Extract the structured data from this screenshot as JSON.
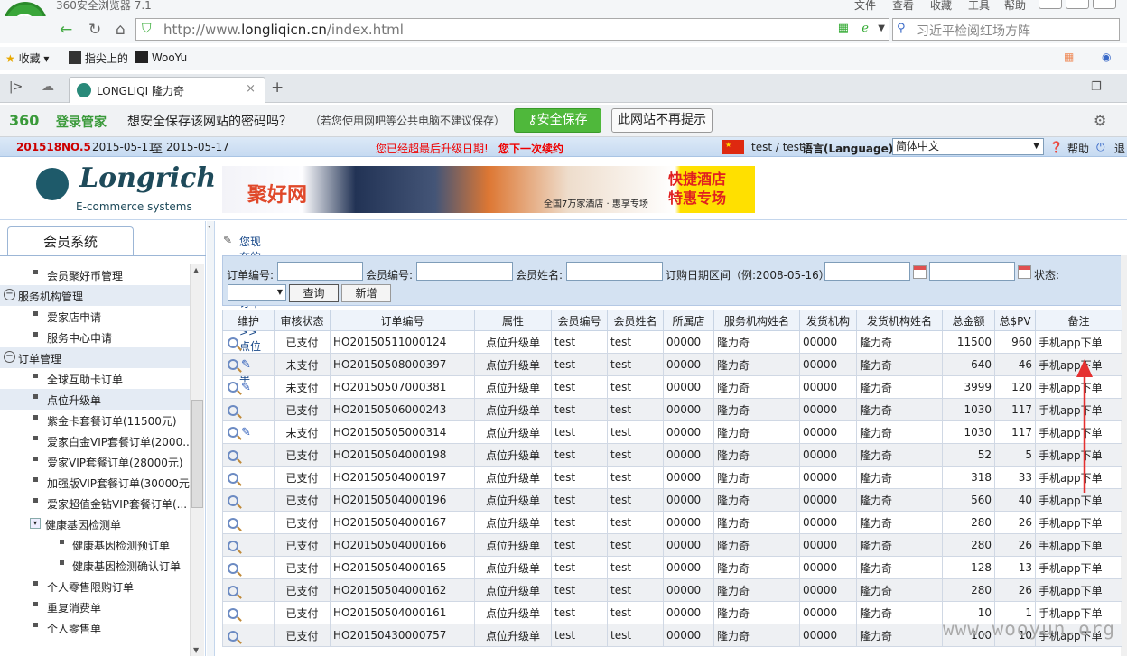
{
  "browser": {
    "app_title": "360安全浏览器 7.1",
    "menus": [
      "文件",
      "查看",
      "收藏",
      "工具",
      "帮助"
    ],
    "url_prefix": "http://www.",
    "url_host": "longliqicn.cn",
    "url_path": "/index.html",
    "search_text": "习近平检阅红场方阵",
    "bookmarks": [
      "收藏",
      "指尖上的",
      "WooYu"
    ],
    "tab_title": "LONGLIQI 隆力奇",
    "pw_brand": "360",
    "pw_mgr": "登录管家",
    "pw_question": "想安全保存该网站的密码吗？",
    "pw_note": "（若您使用网吧等公共电脑不建议保存）",
    "pw_save": "安全保存",
    "pw_no": "此网站不再提示"
  },
  "info": {
    "period": "201518",
    "no_label": "NO.5",
    "date_from": "2015-05-11",
    "date_sep": "至",
    "date_to": "2015-05-17",
    "notice1": "您已经超最后升级日期!",
    "notice2": "您下一次续约",
    "user": "test / test",
    "lang_label": "语言(Language):",
    "lang_value": "简体中文",
    "help": "帮助",
    "logout": "退"
  },
  "header": {
    "brand": "Longrich",
    "sub": "E-commerce systems",
    "banner_site": "聚好网",
    "banner_mid": "全国7万家酒店 · 惠享专场",
    "banner_right_1": "快捷酒店",
    "banner_right_2": "特惠专场"
  },
  "sidebar": {
    "tab": "会员系统",
    "items": [
      {
        "kind": "lv1",
        "label": "会员聚好币管理"
      },
      {
        "kind": "grp",
        "label": "服务机构管理"
      },
      {
        "kind": "lv1",
        "label": "爱家店申请"
      },
      {
        "kind": "lv1",
        "label": "服务中心申请"
      },
      {
        "kind": "grp",
        "label": "订单管理"
      },
      {
        "kind": "lv1",
        "label": "全球互助卡订单"
      },
      {
        "kind": "lv1",
        "label": "点位升级单",
        "active": true
      },
      {
        "kind": "lv1",
        "label": "紫金卡套餐订单(11500元)"
      },
      {
        "kind": "lv1",
        "label": "爱家白金VIP套餐订单(2000..."
      },
      {
        "kind": "lv1",
        "label": "爱家VIP套餐订单(28000元)"
      },
      {
        "kind": "lv1",
        "label": "加强版VIP套餐订单(30000元)"
      },
      {
        "kind": "lv1",
        "label": "爱家超值金钻VIP套餐订单(..."
      },
      {
        "kind": "sub",
        "label": "健康基因检测单"
      },
      {
        "kind": "lv2",
        "label": "健康基因检测预订单"
      },
      {
        "kind": "lv2",
        "label": "健康基因检测确认订单"
      },
      {
        "kind": "lv1",
        "label": "个人零售限购订单"
      },
      {
        "kind": "lv1",
        "label": "重复消费单"
      },
      {
        "kind": "lv1",
        "label": "个人零售单"
      }
    ]
  },
  "main": {
    "crumb": "您现在的位置：订单管理>>点位升级单",
    "filter": {
      "order_no": "订单编号:",
      "member_no": "会员编号:",
      "member_name": "会员姓名:",
      "date_range": "订购日期区间（例:2008-05-16）:",
      "status": "状态:",
      "query": "查询",
      "add": "新增"
    },
    "columns": [
      "维护",
      "审核状态",
      "订单编号",
      "属性",
      "会员编号",
      "会员姓名",
      "所属店",
      "服务机构姓名",
      "发货机构",
      "发货机构姓名",
      "总金额",
      "总$PV",
      "备注"
    ],
    "rows": [
      {
        "edit": false,
        "status": "已支付",
        "order": "HO20150511000124",
        "attr": "点位升级单",
        "mno": "test",
        "mname": "test",
        "store": "00000",
        "svc": "隆力奇",
        "ship": "00000",
        "shipname": "隆力奇",
        "amount": "11500",
        "pv": "960",
        "note": "手机app下单"
      },
      {
        "edit": true,
        "status": "未支付",
        "order": "HO20150508000397",
        "attr": "点位升级单",
        "mno": "test",
        "mname": "test",
        "store": "00000",
        "svc": "隆力奇",
        "ship": "00000",
        "shipname": "隆力奇",
        "amount": "640",
        "pv": "46",
        "note": "手机app下单"
      },
      {
        "edit": true,
        "status": "未支付",
        "order": "HO20150507000381",
        "attr": "点位升级单",
        "mno": "test",
        "mname": "test",
        "store": "00000",
        "svc": "隆力奇",
        "ship": "00000",
        "shipname": "隆力奇",
        "amount": "3999",
        "pv": "120",
        "note": "手机app下单"
      },
      {
        "edit": false,
        "status": "已支付",
        "order": "HO20150506000243",
        "attr": "点位升级单",
        "mno": "test",
        "mname": "test",
        "store": "00000",
        "svc": "隆力奇",
        "ship": "00000",
        "shipname": "隆力奇",
        "amount": "1030",
        "pv": "117",
        "note": "手机app下单"
      },
      {
        "edit": true,
        "status": "未支付",
        "order": "HO20150505000314",
        "attr": "点位升级单",
        "mno": "test",
        "mname": "test",
        "store": "00000",
        "svc": "隆力奇",
        "ship": "00000",
        "shipname": "隆力奇",
        "amount": "1030",
        "pv": "117",
        "note": "手机app下单"
      },
      {
        "edit": false,
        "status": "已支付",
        "order": "HO20150504000198",
        "attr": "点位升级单",
        "mno": "test",
        "mname": "test",
        "store": "00000",
        "svc": "隆力奇",
        "ship": "00000",
        "shipname": "隆力奇",
        "amount": "52",
        "pv": "5",
        "note": "手机app下单"
      },
      {
        "edit": false,
        "status": "已支付",
        "order": "HO20150504000197",
        "attr": "点位升级单",
        "mno": "test",
        "mname": "test",
        "store": "00000",
        "svc": "隆力奇",
        "ship": "00000",
        "shipname": "隆力奇",
        "amount": "318",
        "pv": "33",
        "note": "手机app下单"
      },
      {
        "edit": false,
        "status": "已支付",
        "order": "HO20150504000196",
        "attr": "点位升级单",
        "mno": "test",
        "mname": "test",
        "store": "00000",
        "svc": "隆力奇",
        "ship": "00000",
        "shipname": "隆力奇",
        "amount": "560",
        "pv": "40",
        "note": "手机app下单"
      },
      {
        "edit": false,
        "status": "已支付",
        "order": "HO20150504000167",
        "attr": "点位升级单",
        "mno": "test",
        "mname": "test",
        "store": "00000",
        "svc": "隆力奇",
        "ship": "00000",
        "shipname": "隆力奇",
        "amount": "280",
        "pv": "26",
        "note": "手机app下单"
      },
      {
        "edit": false,
        "status": "已支付",
        "order": "HO20150504000166",
        "attr": "点位升级单",
        "mno": "test",
        "mname": "test",
        "store": "00000",
        "svc": "隆力奇",
        "ship": "00000",
        "shipname": "隆力奇",
        "amount": "280",
        "pv": "26",
        "note": "手机app下单"
      },
      {
        "edit": false,
        "status": "已支付",
        "order": "HO20150504000165",
        "attr": "点位升级单",
        "mno": "test",
        "mname": "test",
        "store": "00000",
        "svc": "隆力奇",
        "ship": "00000",
        "shipname": "隆力奇",
        "amount": "128",
        "pv": "13",
        "note": "手机app下单"
      },
      {
        "edit": false,
        "status": "已支付",
        "order": "HO20150504000162",
        "attr": "点位升级单",
        "mno": "test",
        "mname": "test",
        "store": "00000",
        "svc": "隆力奇",
        "ship": "00000",
        "shipname": "隆力奇",
        "amount": "280",
        "pv": "26",
        "note": "手机app下单"
      },
      {
        "edit": false,
        "status": "已支付",
        "order": "HO20150504000161",
        "attr": "点位升级单",
        "mno": "test",
        "mname": "test",
        "store": "00000",
        "svc": "隆力奇",
        "ship": "00000",
        "shipname": "隆力奇",
        "amount": "10",
        "pv": "1",
        "note": "手机app下单"
      },
      {
        "edit": false,
        "status": "已支付",
        "order": "HO20150430000757",
        "attr": "点位升级单",
        "mno": "test",
        "mname": "test",
        "store": "00000",
        "svc": "隆力奇",
        "ship": "00000",
        "shipname": "隆力奇",
        "amount": "100",
        "pv": "10",
        "note": "手机app下单"
      }
    ]
  },
  "watermark": "www.wooyun.org"
}
